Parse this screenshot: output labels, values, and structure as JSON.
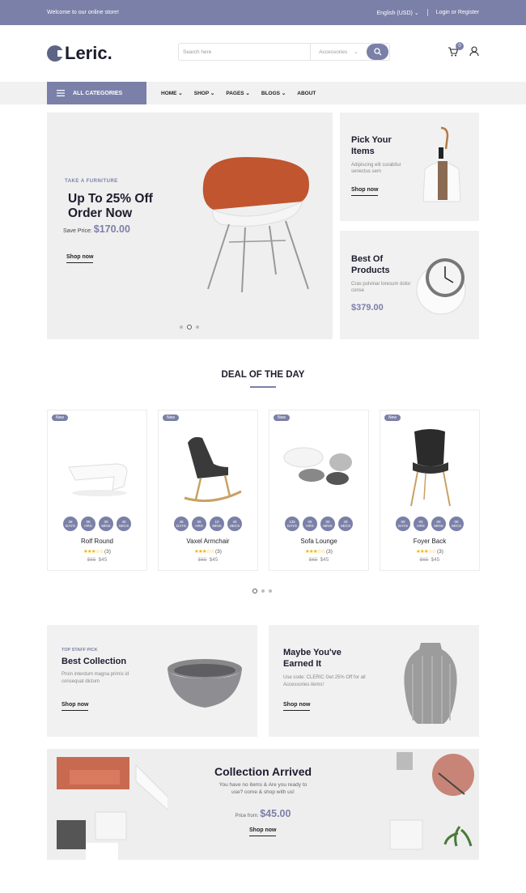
{
  "topbar": {
    "welcome": "Welcome to our online store!",
    "currency": "English (USD)",
    "account": "Login or Register"
  },
  "header": {
    "logo": "Leric.",
    "search_placeholder": "Search here",
    "category": "Accessories",
    "cart_count": "0"
  },
  "nav": {
    "all_categories": "ALL CATEGORIES",
    "items": [
      "HOME",
      "SHOP",
      "PAGES",
      "BLOGS",
      "ABOUT"
    ]
  },
  "hero": {
    "tag": "TAKE A FURNITURE",
    "title": "Up To 25% Off Order Now",
    "price_label": "Save Price:",
    "price": "$170.00",
    "cta": "Shop now"
  },
  "side1": {
    "title": "Pick Your Items",
    "text": "Adipiscing elit curabitur senectus sem",
    "cta": "Shop now"
  },
  "side2": {
    "title": "Best Of Products",
    "text": "Cras pulvinar loresum dolor conse",
    "price": "$379.00"
  },
  "deal": {
    "title": "DEAL OF THE DAY"
  },
  "products": [
    {
      "badge": "New",
      "name": "Rolf Round",
      "reviews": "(3)",
      "old": "$65",
      "price": "$45",
      "timer": [
        [
          "38",
          "DAYS"
        ],
        [
          "08",
          "HRS"
        ],
        [
          "30",
          "MINS"
        ],
        [
          "40",
          "SECS"
        ]
      ]
    },
    {
      "badge": "New",
      "name": "Vaxel Armchair",
      "reviews": "(3)",
      "old": "$65",
      "price": "$45",
      "timer": [
        [
          "48",
          "DAYS"
        ],
        [
          "09",
          "HRS"
        ],
        [
          "10",
          "MINS"
        ],
        [
          "40",
          "SECS"
        ]
      ]
    },
    {
      "badge": "New",
      "name": "Sofa Lounge",
      "reviews": "(3)",
      "old": "$65",
      "price": "$45",
      "timer": [
        [
          "135",
          "DAYS"
        ],
        [
          "09",
          "HRS"
        ],
        [
          "00",
          "MINS"
        ],
        [
          "40",
          "SECS"
        ]
      ]
    },
    {
      "badge": "New",
      "name": "Foyer Back",
      "reviews": "(3)",
      "old": "$65",
      "price": "$45",
      "timer": [
        [
          "00",
          "DAYS"
        ],
        [
          "00",
          "HRS"
        ],
        [
          "00",
          "MINS"
        ],
        [
          "00",
          "SECS"
        ]
      ]
    }
  ],
  "banner1": {
    "tag": "TOP STAFF PICK",
    "title": "Best Collection",
    "text": "Proin interdum magna primis id consequat dictum",
    "cta": "Shop now"
  },
  "banner2": {
    "title": "Maybe You've Earned It",
    "text": "Use code: CLERIC Get 25% Off for all Accessories items!",
    "cta": "Shop now"
  },
  "collection": {
    "title": "Collection Arrived",
    "text": "You have no items & Are you ready to use? come & shop with us!",
    "price_label": "Price from:",
    "price": "$45.00",
    "cta": "Shop now"
  },
  "colors": {
    "accent": "#7b80a8",
    "dark": "#1c1c2e",
    "panel": "#f1f1f1"
  }
}
